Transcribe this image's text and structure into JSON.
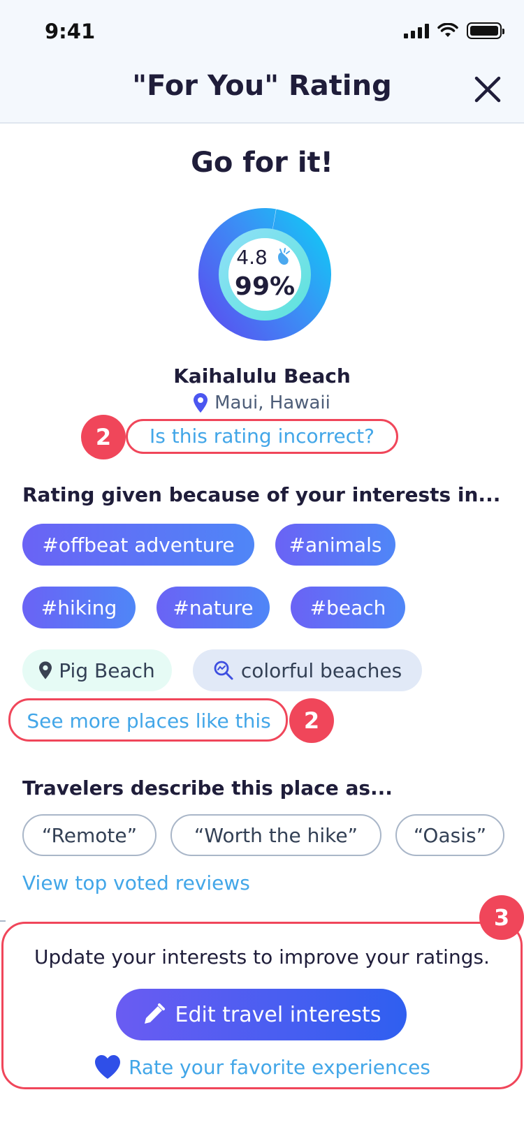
{
  "status_bar": {
    "time": "9:41"
  },
  "header": {
    "title": "\"For You\" Rating",
    "close_icon": "close-icon"
  },
  "score": {
    "verdict": "Go for it!",
    "rating": "4.8",
    "rating_icon": "clapping-hands-icon",
    "percent": "99%",
    "percent_value": 99
  },
  "place": {
    "name": "Kaihalulu Beach",
    "location": "Maui, Hawaii",
    "location_icon": "map-pin-icon"
  },
  "annotations": {
    "badge_incorrect": "2",
    "badge_see_more": "2",
    "badge_bottom": "3"
  },
  "incorrect_link": "Is this rating incorrect?",
  "interests": {
    "title": "Rating given because of your interests in...",
    "tags": [
      "#offbeat adventure",
      "#animals",
      "#hiking",
      "#nature",
      "#beach"
    ],
    "place_chip": "Pig Beach",
    "search_chip": "colorful beaches"
  },
  "see_more_link": "See more places like this",
  "travelers": {
    "title": "Travelers describe this place as...",
    "quotes": [
      "“Remote”",
      "“Worth the hike”",
      "“Oasis”"
    ]
  },
  "view_reviews_link": "View top voted reviews",
  "bottom": {
    "text": "Update your interests to improve your ratings.",
    "edit_button": "Edit travel interests",
    "rate_link": "Rate your favorite experiences"
  },
  "colors": {
    "accent_red": "#f0465a",
    "link_blue": "#42a6e8",
    "tag_start": "#6a63f5",
    "tag_end": "#4f86f7"
  }
}
